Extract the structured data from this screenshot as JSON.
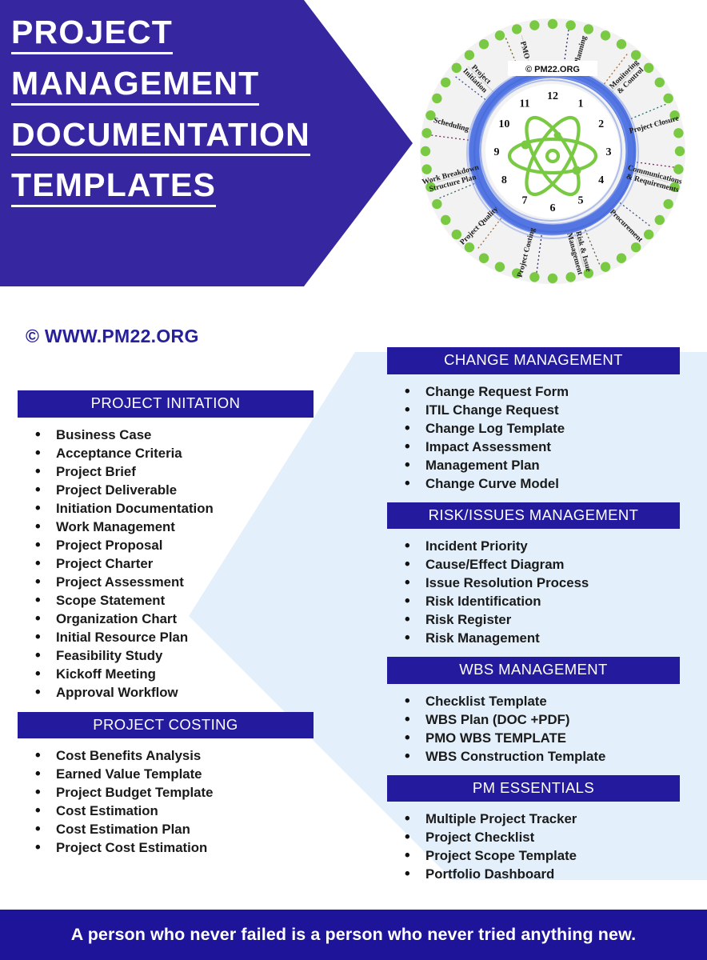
{
  "title": {
    "lines": [
      "PROJECT",
      "MANAGEMENT",
      "DOCUMENTATION",
      "TEMPLATES"
    ]
  },
  "branding": {
    "site_url": "© WWW.PM22.ORG",
    "wheel_brand": "© PM22.ORG"
  },
  "colors": {
    "title_banner": "#3626a0",
    "section_bar": "#231a9e",
    "footer_bar": "#1e1499",
    "panel_light_blue": "#e3f0fb",
    "wheel_ring": "#4a6fe0",
    "wheel_dots": "#7ac943",
    "wheel_face": "#f1f1f1",
    "atom": "#7ac943",
    "url_text": "#26209a"
  },
  "wheel": {
    "segments": [
      "Planning",
      "Monitoring & Control",
      "Project Closure",
      "Communications & Requirements",
      "Procurement",
      "Risk & Issue Management",
      "Project Costing",
      "Project Quality",
      "Work Breakdown Structure Plan",
      "Scheduling",
      "Project Initiation",
      "PMO"
    ],
    "clock_numbers": [
      "1",
      "2",
      "3",
      "4",
      "5",
      "6",
      "7",
      "8",
      "9",
      "10",
      "11",
      "12"
    ],
    "center_icon": "atom-icon"
  },
  "left_column": {
    "sections": [
      {
        "heading": "PROJECT INITATION",
        "items": [
          "Business Case",
          "Acceptance Criteria",
          "Project Brief",
          "Project Deliverable",
          "Initiation Documentation",
          "Work Management",
          "Project Proposal",
          "Project Charter",
          "Project Assessment",
          "Scope Statement",
          "Organization Chart",
          "Initial Resource Plan",
          "Feasibility Study",
          "Kickoff Meeting",
          "Approval Workflow"
        ]
      },
      {
        "heading": "PROJECT COSTING",
        "items": [
          "Cost Benefits Analysis",
          "Earned Value Template",
          "Project Budget Template",
          "Cost Estimation",
          "Cost Estimation Plan",
          "Project Cost Estimation"
        ]
      }
    ]
  },
  "right_column": {
    "sections": [
      {
        "heading": "CHANGE MANAGEMENT",
        "items": [
          "Change Request Form",
          "ITIL Change Request",
          "Change Log Template",
          "Impact Assessment",
          "Management Plan",
          "Change Curve Model"
        ]
      },
      {
        "heading": "RISK/ISSUES MANAGEMENT",
        "items": [
          "Incident Priority",
          "Cause/Effect Diagram",
          "Issue Resolution Process",
          "Risk Identification",
          "Risk Register",
          "Risk Management"
        ]
      },
      {
        "heading": "WBS MANAGEMENT",
        "items": [
          "Checklist Template",
          "WBS Plan (DOC +PDF)",
          "PMO WBS TEMPLATE",
          "WBS Construction Template"
        ]
      },
      {
        "heading": "PM ESSENTIALS",
        "items": [
          "Multiple Project Tracker",
          "Project Checklist",
          "Project Scope Template",
          "Portfolio Dashboard"
        ]
      }
    ]
  },
  "footer": {
    "quote": "A person who never failed is a person who never tried anything new."
  }
}
